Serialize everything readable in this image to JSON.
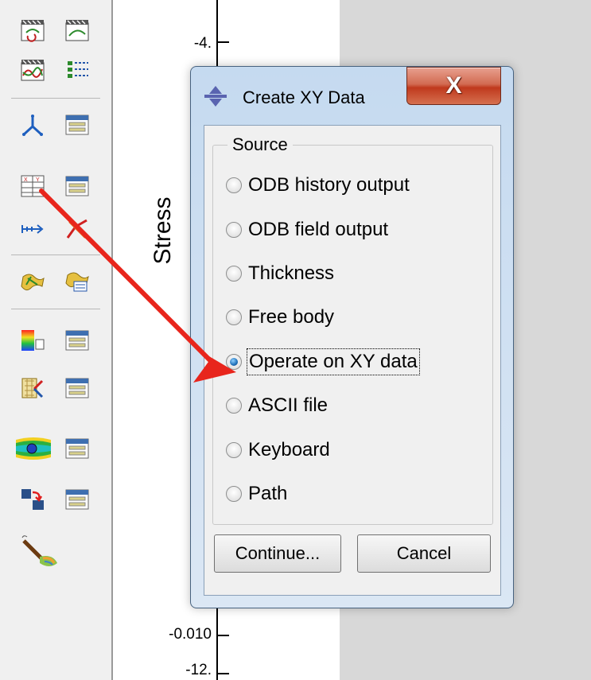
{
  "plot": {
    "ylabel": "Stress",
    "ticks": [
      "-4.",
      "-0.010",
      "-12."
    ]
  },
  "toolbar": {
    "icons": [
      "create-xy-animation-icon",
      "animate-xy-icon",
      "xy-plot-animation-icon",
      "list-options-icon",
      "axis-triad-icon",
      "triad-options-icon",
      "xy-data-icon",
      "xy-data-options-icon",
      "path-icon",
      "path-options-icon",
      "viewcut-icon",
      "viewcut-manager-icon",
      "color-code-icon",
      "color-options-icon",
      "streamline-icon",
      "stream-options-icon",
      "flow-icon",
      "flow-options-icon",
      "transfer-icon",
      "transfer-options-icon",
      "probe-icon"
    ]
  },
  "dialog": {
    "title": "Create XY Data",
    "close_label": "X",
    "group_label": "Source",
    "options": [
      {
        "label": "ODB history output",
        "checked": false
      },
      {
        "label": "ODB field output",
        "checked": false
      },
      {
        "label": "Thickness",
        "checked": false
      },
      {
        "label": "Free body",
        "checked": false
      },
      {
        "label": "Operate on XY data",
        "checked": true
      },
      {
        "label": "ASCII file",
        "checked": false
      },
      {
        "label": "Keyboard",
        "checked": false
      },
      {
        "label": "Path",
        "checked": false
      }
    ],
    "continue_label": "Continue...",
    "cancel_label": "Cancel"
  },
  "colors": {
    "arrow": "#e8251c",
    "titlebar": "#c5daf0",
    "close_button": "#c0391d"
  }
}
